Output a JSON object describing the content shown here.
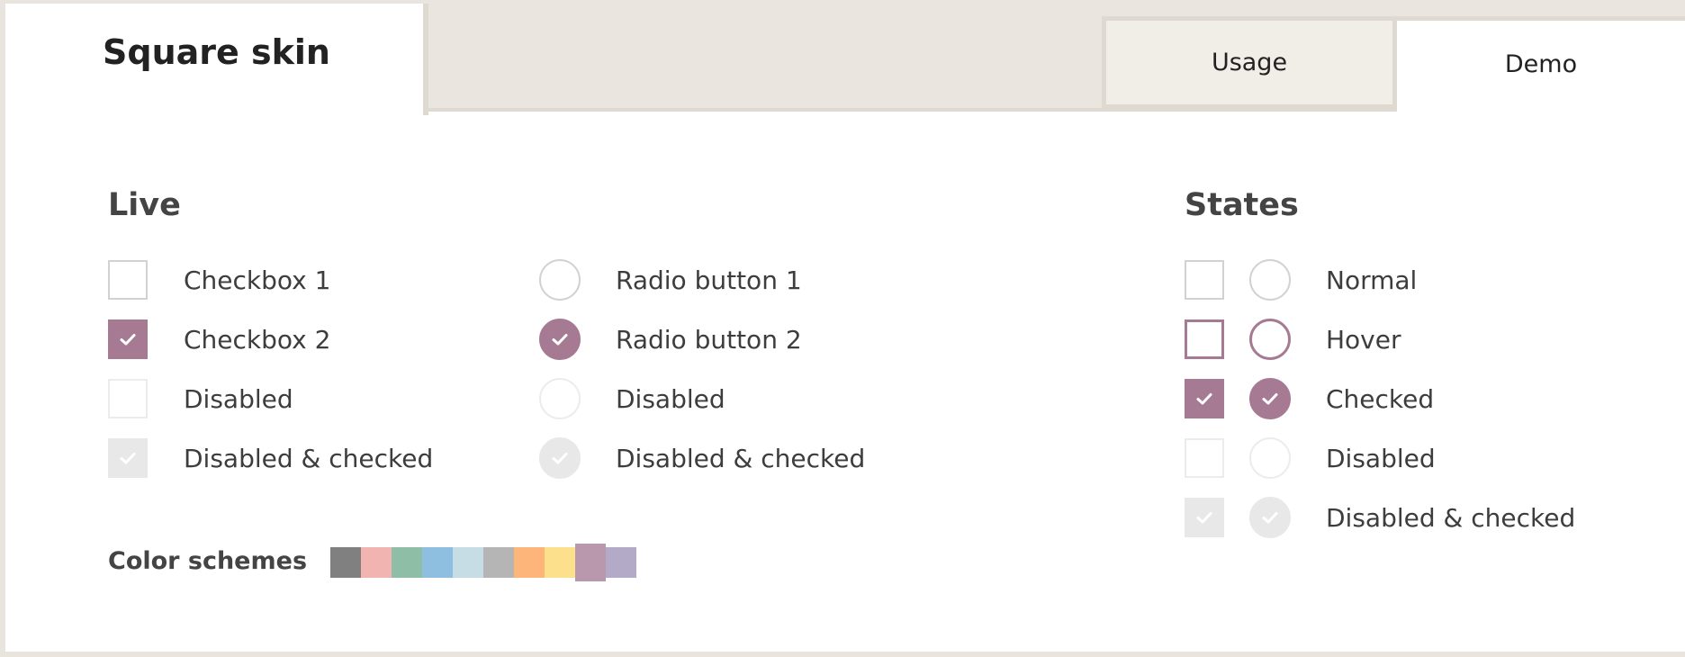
{
  "header": {
    "title": "Square skin",
    "tabs": [
      {
        "label": "Usage",
        "active": false
      },
      {
        "label": "Demo",
        "active": true
      }
    ]
  },
  "live": {
    "title": "Live",
    "checkboxes": [
      {
        "label": "Checkbox 1",
        "state": "normal"
      },
      {
        "label": "Checkbox 2",
        "state": "checked"
      },
      {
        "label": "Disabled",
        "state": "disabled"
      },
      {
        "label": "Disabled & checked",
        "state": "disabled-checked"
      }
    ],
    "radios": [
      {
        "label": "Radio button 1",
        "state": "normal"
      },
      {
        "label": "Radio button 2",
        "state": "checked"
      },
      {
        "label": "Disabled",
        "state": "disabled"
      },
      {
        "label": "Disabled & checked",
        "state": "disabled-checked"
      }
    ]
  },
  "states": {
    "title": "States",
    "items": [
      {
        "label": "Normal",
        "state": "normal"
      },
      {
        "label": "Hover",
        "state": "hover"
      },
      {
        "label": "Checked",
        "state": "checked"
      },
      {
        "label": "Disabled",
        "state": "disabled"
      },
      {
        "label": "Disabled & checked",
        "state": "disabled-checked"
      }
    ]
  },
  "color_schemes": {
    "label": "Color schemes",
    "swatches": [
      {
        "name": "black",
        "color": "#808080",
        "active": false
      },
      {
        "name": "red",
        "color": "#f1b4b0",
        "active": false
      },
      {
        "name": "green",
        "color": "#8ebfa6",
        "active": false
      },
      {
        "name": "blue",
        "color": "#8fbfe0",
        "active": false
      },
      {
        "name": "aero",
        "color": "#c6dde5",
        "active": false
      },
      {
        "name": "grey",
        "color": "#b5b5b5",
        "active": false
      },
      {
        "name": "orange",
        "color": "#fdb57a",
        "active": false
      },
      {
        "name": "yellow",
        "color": "#fde08c",
        "active": false
      },
      {
        "name": "pink",
        "color": "#b998ae",
        "active": true
      },
      {
        "name": "purple",
        "color": "#b2aac6",
        "active": false
      }
    ]
  },
  "colors": {
    "accent": "#a77a94",
    "frame": "#dedad1",
    "header_bg": "#eae6df"
  }
}
